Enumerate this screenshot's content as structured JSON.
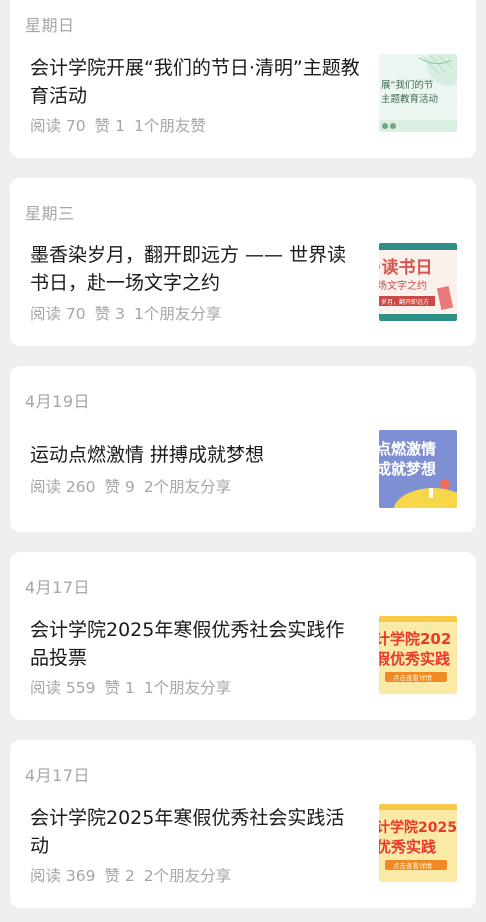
{
  "articles": [
    {
      "date": "星期日",
      "title": "会计学院开展“我们的节日·清明”主题教育活动",
      "reads": "阅读 70",
      "likes": "赞 1",
      "friends": "1个朋友赞",
      "thumb_text": [
        "展“我们的节",
        "主题教育活动"
      ]
    },
    {
      "date": "星期三",
      "title": "墨香染岁月，翻开即远方 —— 世界读书日，赴一场文字之约",
      "reads": "阅读 70",
      "likes": "赞 3",
      "friends": "1个朋友分享",
      "thumb_text": [
        "·读书日",
        "场文字之约",
        "岁月，翻开即远方"
      ]
    },
    {
      "date": "4月19日",
      "title": "运动点燃激情  拼搏成就梦想",
      "reads": "阅读 260",
      "likes": "赞 9",
      "friends": "2个朋友分享",
      "thumb_text": [
        "点燃激情",
        "成就梦想"
      ]
    },
    {
      "date": "4月17日",
      "title": "会计学院2025年寒假优秀社会实践作品投票",
      "reads": "阅读 559",
      "likes": "赞 1",
      "friends": "1个朋友分享",
      "thumb_text": [
        "计学院202",
        "假优秀实践",
        "点击查看详情"
      ]
    },
    {
      "date": "4月17日",
      "title": "会计学院2025年寒假优秀社会实践活动",
      "reads": "阅读 369",
      "likes": "赞 2",
      "friends": "2个朋友分享",
      "thumb_text": [
        "计学院2025",
        "优秀实践",
        "点击查看详情"
      ]
    }
  ],
  "colors": {
    "card_bg": "#ffffff",
    "page_bg": "#efefef",
    "title_text": "#1a1a1a",
    "meta_text": "#a6a6a6"
  }
}
